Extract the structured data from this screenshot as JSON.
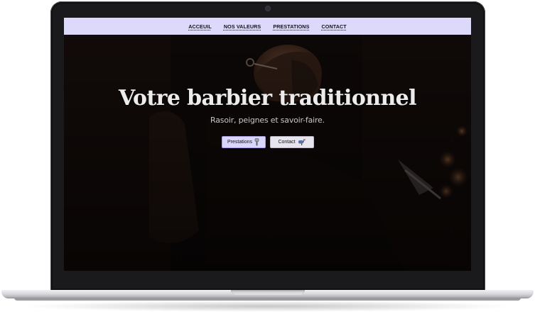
{
  "nav": {
    "items": [
      {
        "label": "ACCEUIL"
      },
      {
        "label": "NOS VALEURS"
      },
      {
        "label": "PRESTATIONS"
      },
      {
        "label": "CONTACT"
      }
    ]
  },
  "hero": {
    "title": "Votre barbier traditionnel",
    "subtitle": "Rasoir, peignes et savoir-faire.",
    "primary_button": {
      "label": "Prestations",
      "icon": "razor-icon"
    },
    "secondary_button": {
      "label": "Contact",
      "icon": "mailbox-icon"
    }
  },
  "colors": {
    "navbar_bg": "#ddd9fb",
    "primary_button_bg": "#d9d5fb",
    "secondary_button_bg": "#e6e4ee",
    "hero_text": "#ececec",
    "screen_bg": "#0b0808"
  }
}
